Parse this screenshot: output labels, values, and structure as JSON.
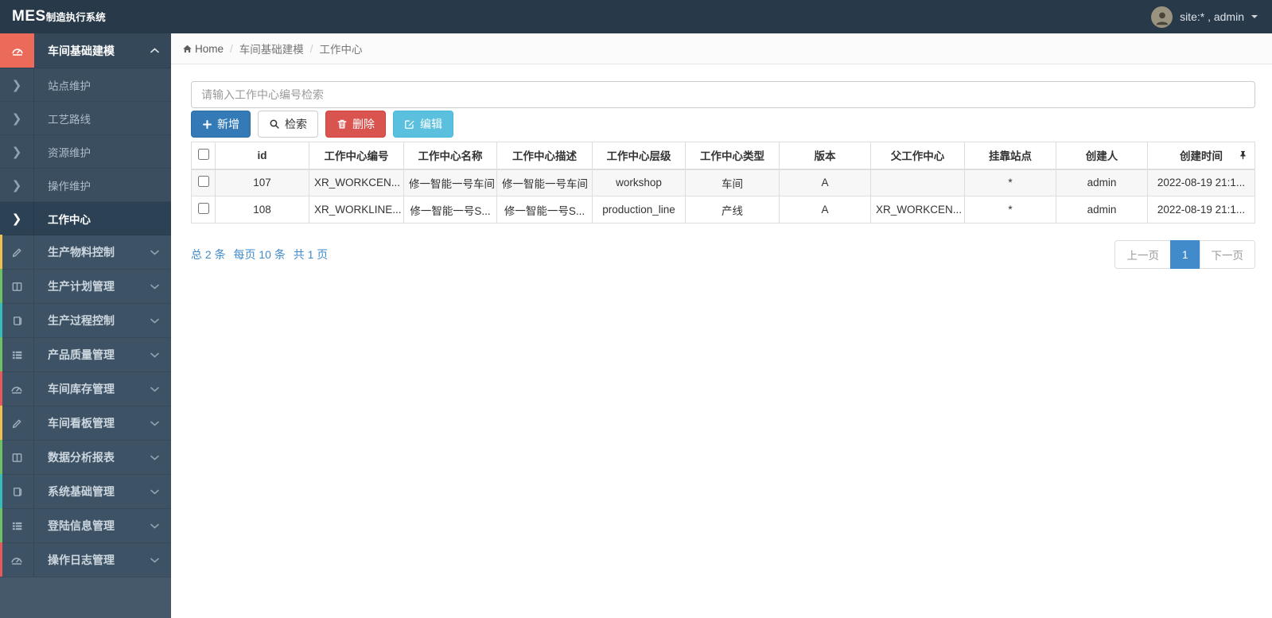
{
  "navbar": {
    "logo_primary": "MES",
    "logo_secondary": "制造执行系统",
    "user_label": "site:* , admin"
  },
  "breadcrumb": {
    "separator": "/",
    "items": [
      "Home",
      "车间基础建模",
      "工作中心"
    ]
  },
  "sidebar": {
    "expanded_group": {
      "label": "车间基础建模",
      "icon": "dashboard-icon",
      "children": [
        {
          "label": "站点维护",
          "active": false
        },
        {
          "label": "工艺路线",
          "active": false
        },
        {
          "label": "资源维护",
          "active": false
        },
        {
          "label": "操作维护",
          "active": false
        },
        {
          "label": "工作中心",
          "active": true
        }
      ]
    },
    "sub_caret": "❯",
    "items": [
      {
        "label": "生产物料控制",
        "icon": "edit-icon",
        "strip_color": "#f0c04c"
      },
      {
        "label": "生产计划管理",
        "icon": "columns-icon",
        "strip_color": "#6fbf63"
      },
      {
        "label": "生产过程控制",
        "icon": "book-icon",
        "strip_color": "#35bdb7"
      },
      {
        "label": "产品质量管理",
        "icon": "list-icon",
        "strip_color": "#6fbf63"
      },
      {
        "label": "车间库存管理",
        "icon": "dashboard-icon",
        "strip_color": "#e8595d"
      },
      {
        "label": "车间看板管理",
        "icon": "edit-icon",
        "strip_color": "#f0c04c"
      },
      {
        "label": "数据分析报表",
        "icon": "columns-icon",
        "strip_color": "#6fbf63"
      },
      {
        "label": "系统基础管理",
        "icon": "book-icon",
        "strip_color": "#35bdb7"
      },
      {
        "label": "登陆信息管理",
        "icon": "list-icon",
        "strip_color": "#6fbf63"
      },
      {
        "label": "操作日志管理",
        "icon": "dashboard-icon",
        "strip_color": "#e8595d"
      }
    ]
  },
  "toolbar": {
    "search_placeholder": "请输入工作中心编号检索",
    "add_label": "新增",
    "search_label": "检索",
    "delete_label": "删除",
    "edit_label": "编辑"
  },
  "table": {
    "headers": [
      "id",
      "工作中心编号",
      "工作中心名称",
      "工作中心描述",
      "工作中心层级",
      "工作中心类型",
      "版本",
      "父工作中心",
      "挂靠站点",
      "创建人",
      "创建时间"
    ],
    "rows": [
      [
        "107",
        "XR_WORKCEN...",
        "修一智能一号车间",
        "修一智能一号车间",
        "workshop",
        "车间",
        "A",
        "",
        "*",
        "admin",
        "2022-08-19 21:1..."
      ],
      [
        "108",
        "XR_WORKLINE...",
        "修一智能一号S...",
        "修一智能一号S...",
        "production_line",
        "产线",
        "A",
        "XR_WORKCEN...",
        "*",
        "admin",
        "2022-08-19 21:1..."
      ]
    ]
  },
  "pagination": {
    "summary_total": "总 2 条",
    "summary_per_page": "每页 10 条",
    "summary_pages": "共 1 页",
    "prev_label": "上一页",
    "current_page": "1",
    "next_label": "下一页"
  },
  "colors": {
    "navbar_bg": "#28394a",
    "sidebar_bg": "#3e5265",
    "active_icon_block": "#ec6a5a",
    "primary": "#337ab7",
    "danger": "#d9534f",
    "info": "#5bc0de",
    "link": "#428bca"
  }
}
